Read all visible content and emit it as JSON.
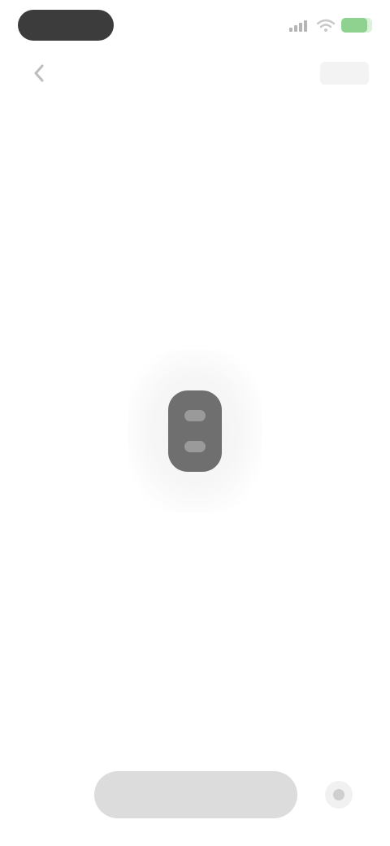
{
  "status_bar": {
    "time": "",
    "icons": [
      "signal-icon",
      "wifi-icon",
      "battery-icon"
    ],
    "battery_color": "#8fd18f"
  },
  "nav_bar": {
    "back_icon": "chevron-left-icon",
    "title": "",
    "action_label": ""
  },
  "center": {
    "icon": "lock-device-icon",
    "icon_color": "#6f6f6f"
  },
  "bottom_bar": {
    "input_label": "",
    "side_icon": "circle-icon"
  }
}
